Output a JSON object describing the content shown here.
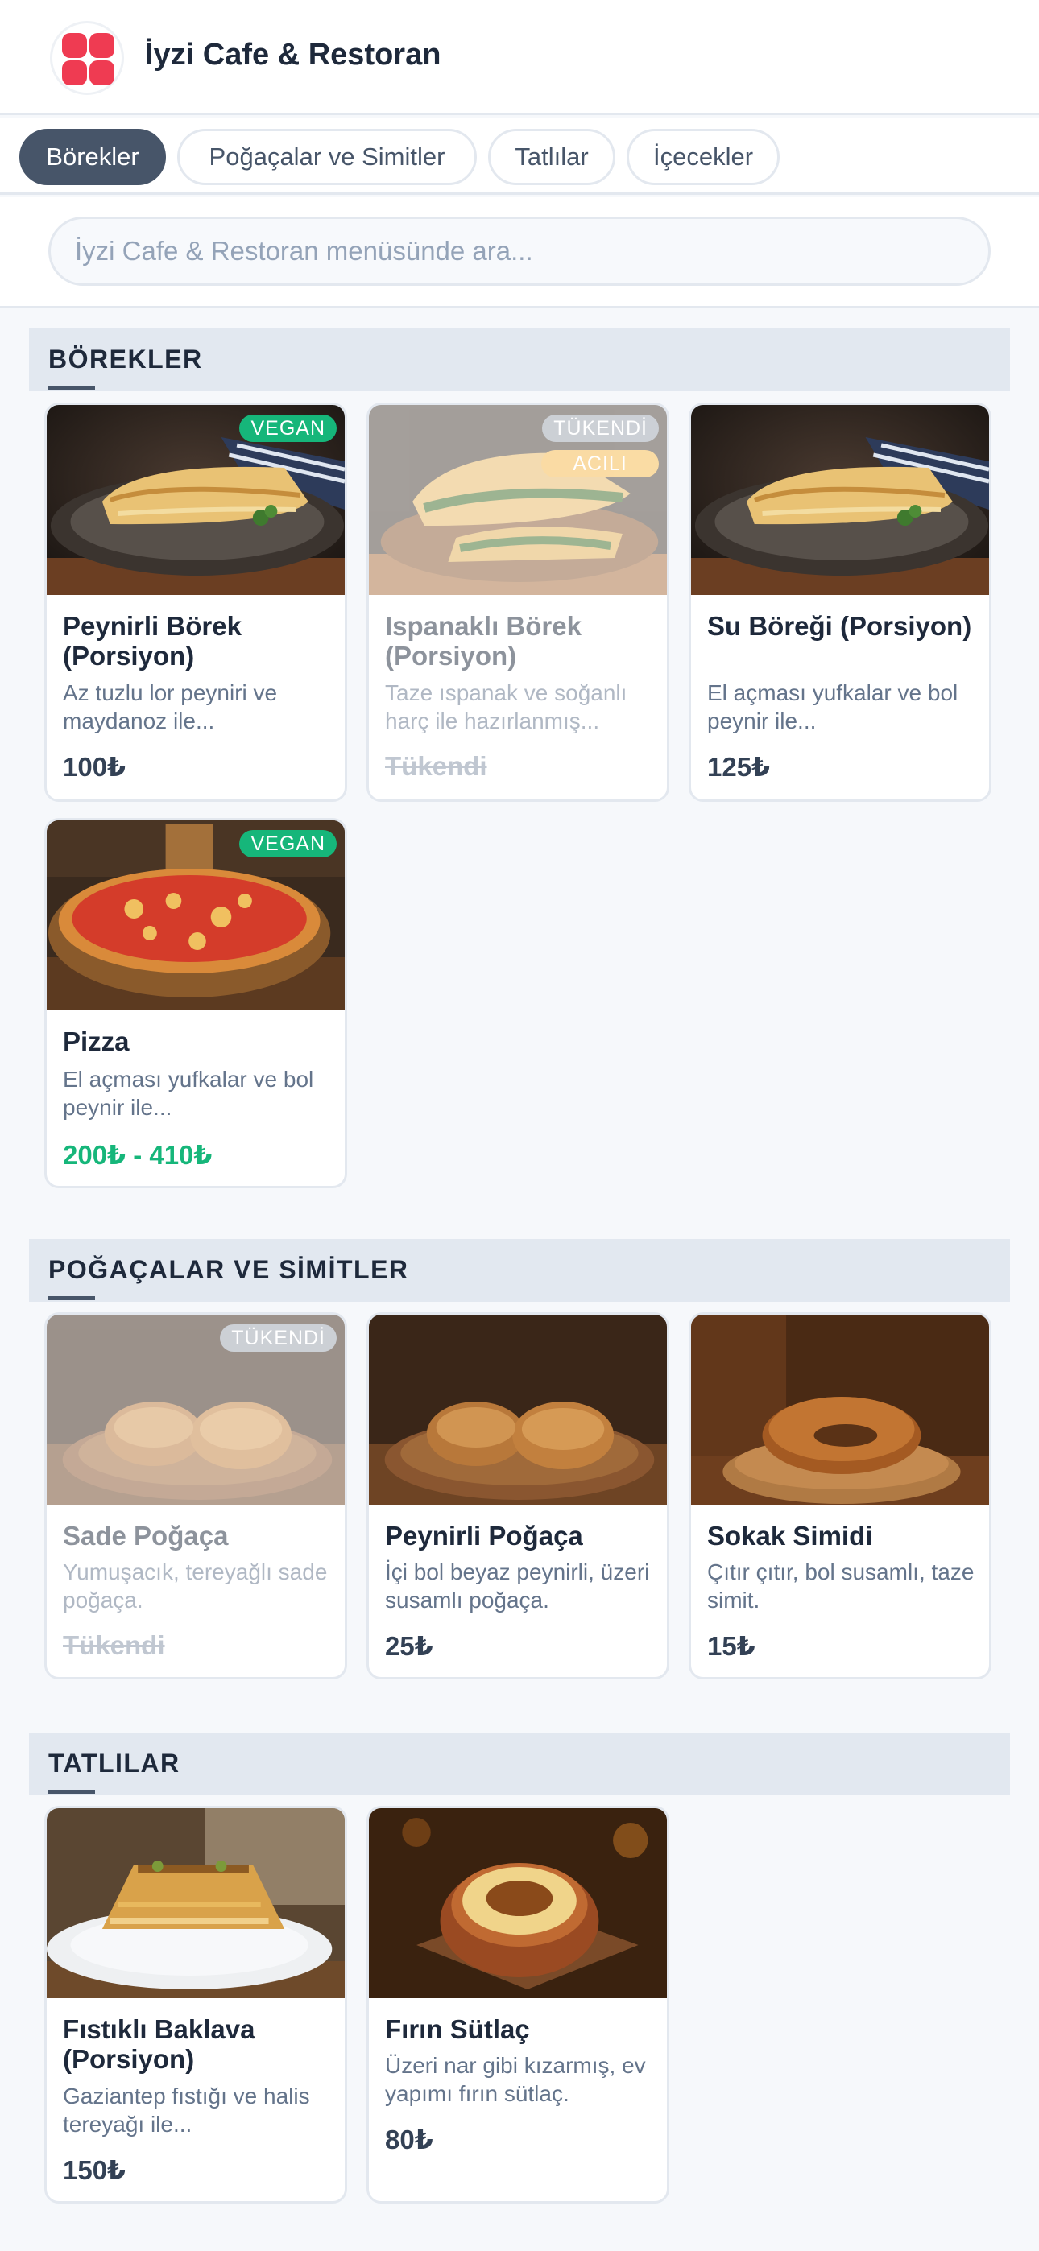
{
  "header": {
    "title": "İyzi Cafe & Restoran"
  },
  "tabs": [
    {
      "label": "Börekler"
    },
    {
      "label": "Poğaçalar ve Simitler"
    },
    {
      "label": "Tatlılar"
    },
    {
      "label": "İçecekler"
    }
  ],
  "search": {
    "placeholder": "İyzi Cafe & Restoran menüsünde ara...",
    "value": ""
  },
  "sections": [
    {
      "title": "BÖREKLER",
      "items": [
        {
          "name": "Peynirli Börek (Porsiyon)",
          "desc": "Az tuzlu lor peyniri ve maydanoz ile...",
          "price": "100₺",
          "badges": [
            "VEGAN"
          ],
          "image": "borek-image"
        },
        {
          "name": "Ispanaklı Börek (Porsiyon)",
          "desc": "Taze ıspanak ve soğanlı harç ile hazırlanmış...",
          "price": "Tükendi",
          "badges": [
            "TÜKENDİ",
            "ACILI"
          ],
          "image": "spinach-borek-image"
        },
        {
          "name": "Su Böreği (Porsiyon)",
          "desc": "El açması yufkalar ve bol peynir ile...",
          "price": "125₺",
          "badges": [],
          "image": "borek-image"
        },
        {
          "name": "Pizza",
          "desc": "El açması yufkalar ve bol peynir ile...",
          "price": "200₺ - 410₺",
          "badges": [
            "VEGAN"
          ],
          "image": "pizza-image"
        }
      ]
    },
    {
      "title": "POĞAÇALAR VE SİMİTLER",
      "items": [
        {
          "name": "Sade Poğaça",
          "desc": "Yumuşacık, tereyağlı sade poğaça.",
          "price": "Tükendi",
          "badges": [
            "TÜKENDİ"
          ],
          "image": "pogaca-image"
        },
        {
          "name": "Peynirli Poğaça",
          "desc": "İçi bol beyaz peynirli, üzeri susamlı poğaça.",
          "price": "25₺",
          "badges": [],
          "image": "pogaca-image"
        },
        {
          "name": "Sokak Simidi",
          "desc": "Çıtır çıtır, bol susamlı, taze simit.",
          "price": "15₺",
          "badges": [],
          "image": "simit-image"
        }
      ]
    },
    {
      "title": "TATLILAR",
      "items": [
        {
          "name": "Fıstıklı Baklava (Porsiyon)",
          "desc": "Gaziantep fıstığı ve halis tereyağı ile...",
          "price": "150₺",
          "badges": [],
          "image": "baklava-image"
        },
        {
          "name": "Fırın Sütlaç",
          "desc": "Üzeri nar gibi kızarmış, ev yapımı fırın sütlaç.",
          "price": "80₺",
          "badges": [],
          "image": "sutlac-image"
        }
      ]
    }
  ],
  "colors": {
    "accent": "#475569",
    "vegan": "#16b67a",
    "soldout": "#9aa2ad",
    "spicy": "#f6b94b",
    "brand": "#ef3b52"
  }
}
